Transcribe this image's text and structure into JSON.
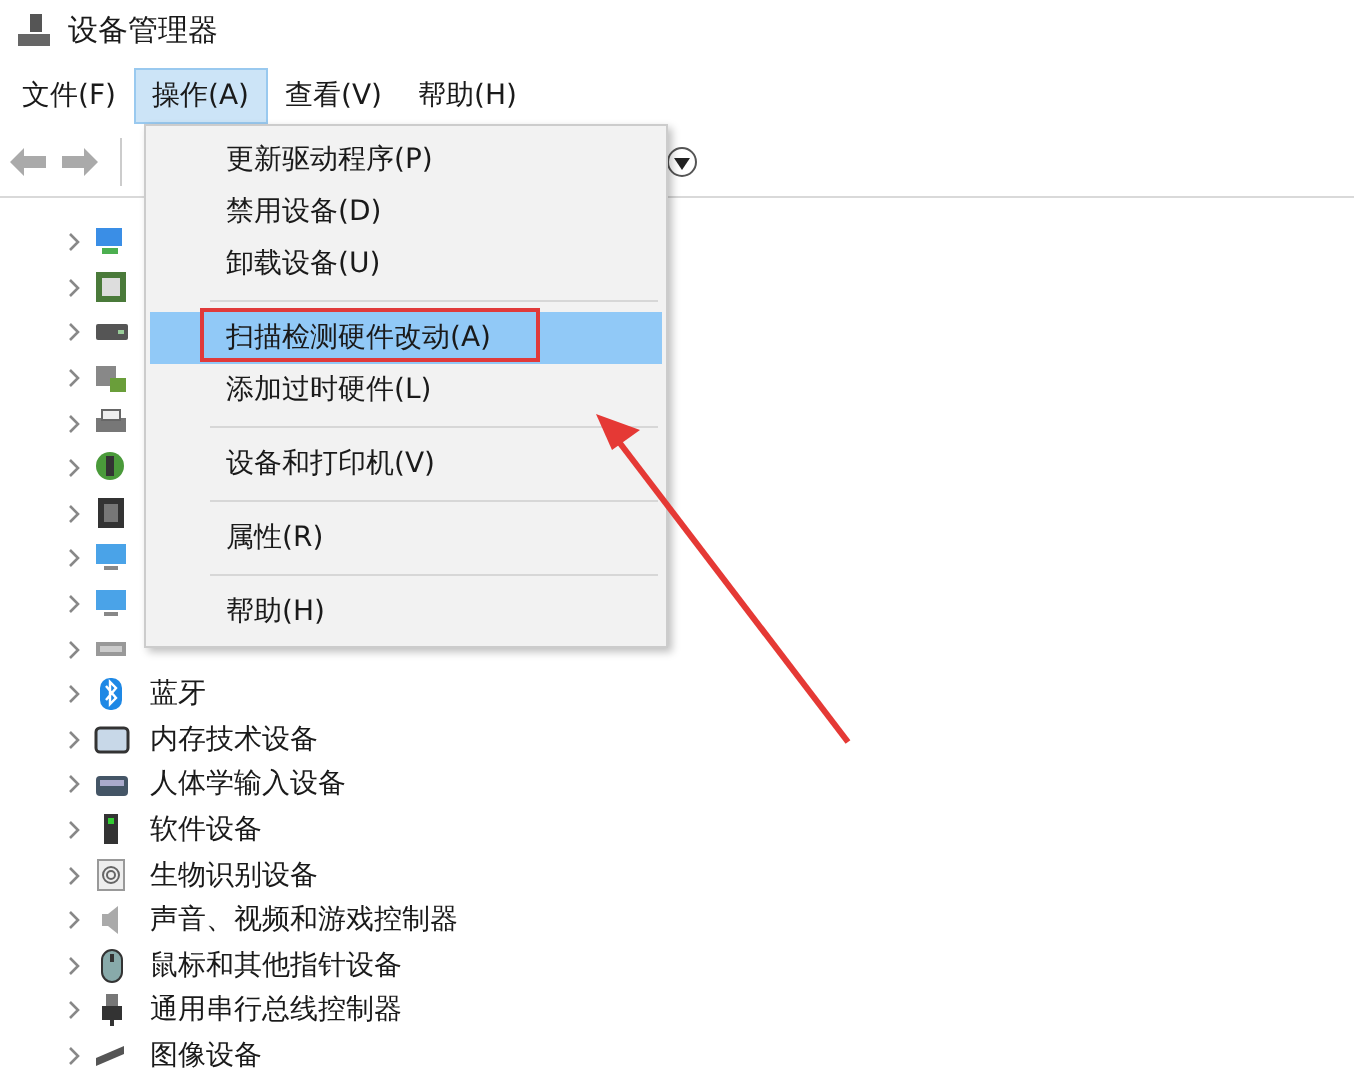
{
  "window": {
    "title": "设备管理器"
  },
  "menu_bar": [
    {
      "label": "文件(F)",
      "selected": false
    },
    {
      "label": "操作(A)",
      "selected": true
    },
    {
      "label": "查看(V)",
      "selected": false
    },
    {
      "label": "帮助(H)",
      "selected": false
    }
  ],
  "action_menu": [
    {
      "kind": "item",
      "label": "更新驱动程序(P)",
      "selected": false
    },
    {
      "kind": "item",
      "label": "禁用设备(D)",
      "selected": false
    },
    {
      "kind": "item",
      "label": "卸载设备(U)",
      "selected": false
    },
    {
      "kind": "separator"
    },
    {
      "kind": "item",
      "label": "扫描检测硬件改动(A)",
      "selected": true
    },
    {
      "kind": "item",
      "label": "添加过时硬件(L)",
      "selected": false
    },
    {
      "kind": "separator"
    },
    {
      "kind": "item",
      "label": "设备和打印机(V)",
      "selected": false
    },
    {
      "kind": "separator"
    },
    {
      "kind": "item",
      "label": "属性(R)",
      "selected": false
    },
    {
      "kind": "separator"
    },
    {
      "kind": "item",
      "label": "帮助(H)",
      "selected": false
    }
  ],
  "tree": [
    {
      "expanded": false
    },
    {
      "expanded": false
    },
    {
      "expanded": false
    },
    {
      "expanded": false
    },
    {
      "expanded": false
    },
    {
      "expanded": false
    },
    {
      "expanded": false
    },
    {
      "expanded": false
    },
    {
      "expanded": false
    },
    {
      "expanded": false
    },
    {
      "label": "蓝牙",
      "expanded": false
    },
    {
      "label": "内存技术设备",
      "expanded": false
    },
    {
      "label": "人体学输入设备",
      "expanded": false
    },
    {
      "label": "软件设备",
      "expanded": false
    },
    {
      "label": "生物识别设备",
      "expanded": false
    },
    {
      "label": "声音、视频和游戏控制器",
      "expanded": false
    },
    {
      "label": "鼠标和其他指针设备",
      "expanded": false
    },
    {
      "label": "通用串行总线控制器",
      "expanded": false
    },
    {
      "label": "图像设备",
      "expanded": false
    }
  ]
}
